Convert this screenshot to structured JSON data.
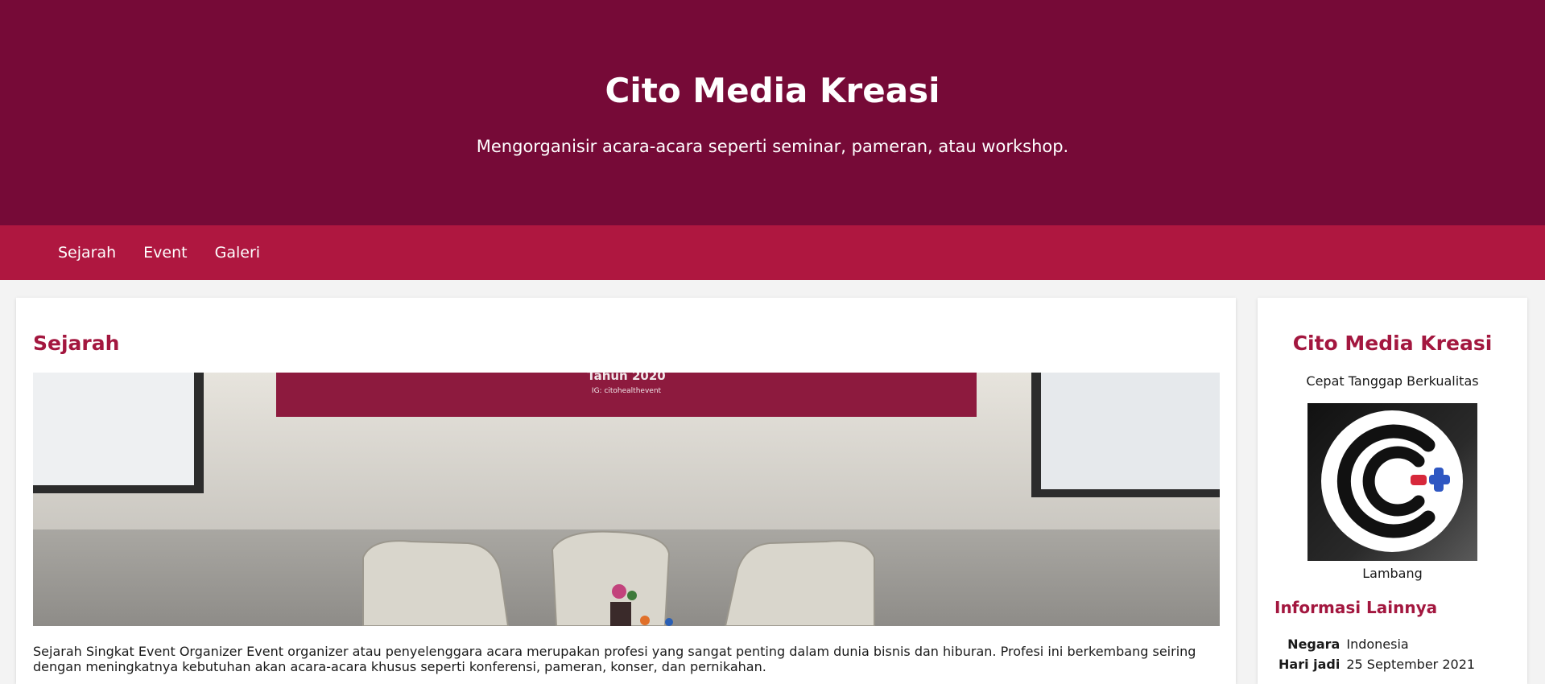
{
  "header": {
    "title": "Cito Media Kreasi",
    "tagline": "Mengorganisir acara-acara seperti seminar, pameran, atau workshop."
  },
  "nav": {
    "items": [
      {
        "label": "Sejarah"
      },
      {
        "label": "Event"
      },
      {
        "label": "Galeri"
      }
    ]
  },
  "main": {
    "section_title": "Sejarah",
    "photo_banner_text": "Tahun 2020",
    "photo_banner_handle": "IG: citohealthevent",
    "text": "Sejarah Singkat Event Organizer Event organizer atau penyelenggara acara merupakan profesi yang sangat penting dalam dunia bisnis dan hiburan. Profesi ini berkembang seiring dengan meningkatnya kebutuhan akan acara-acara khusus seperti konferensi, pameran, konser, dan pernikahan."
  },
  "sidebar": {
    "title": "Cito Media Kreasi",
    "tagline": "Cepat Tanggap Berkualitas",
    "logo_caption": "Lambang",
    "info_title": "Informasi Lainnya",
    "info": [
      {
        "key": "Negara",
        "value": "Indonesia"
      },
      {
        "key": "Hari jadi",
        "value": "25 September 2021"
      }
    ]
  },
  "colors": {
    "header_bg": "#760a37",
    "nav_bg": "#af1740",
    "accent": "#a3173f"
  }
}
